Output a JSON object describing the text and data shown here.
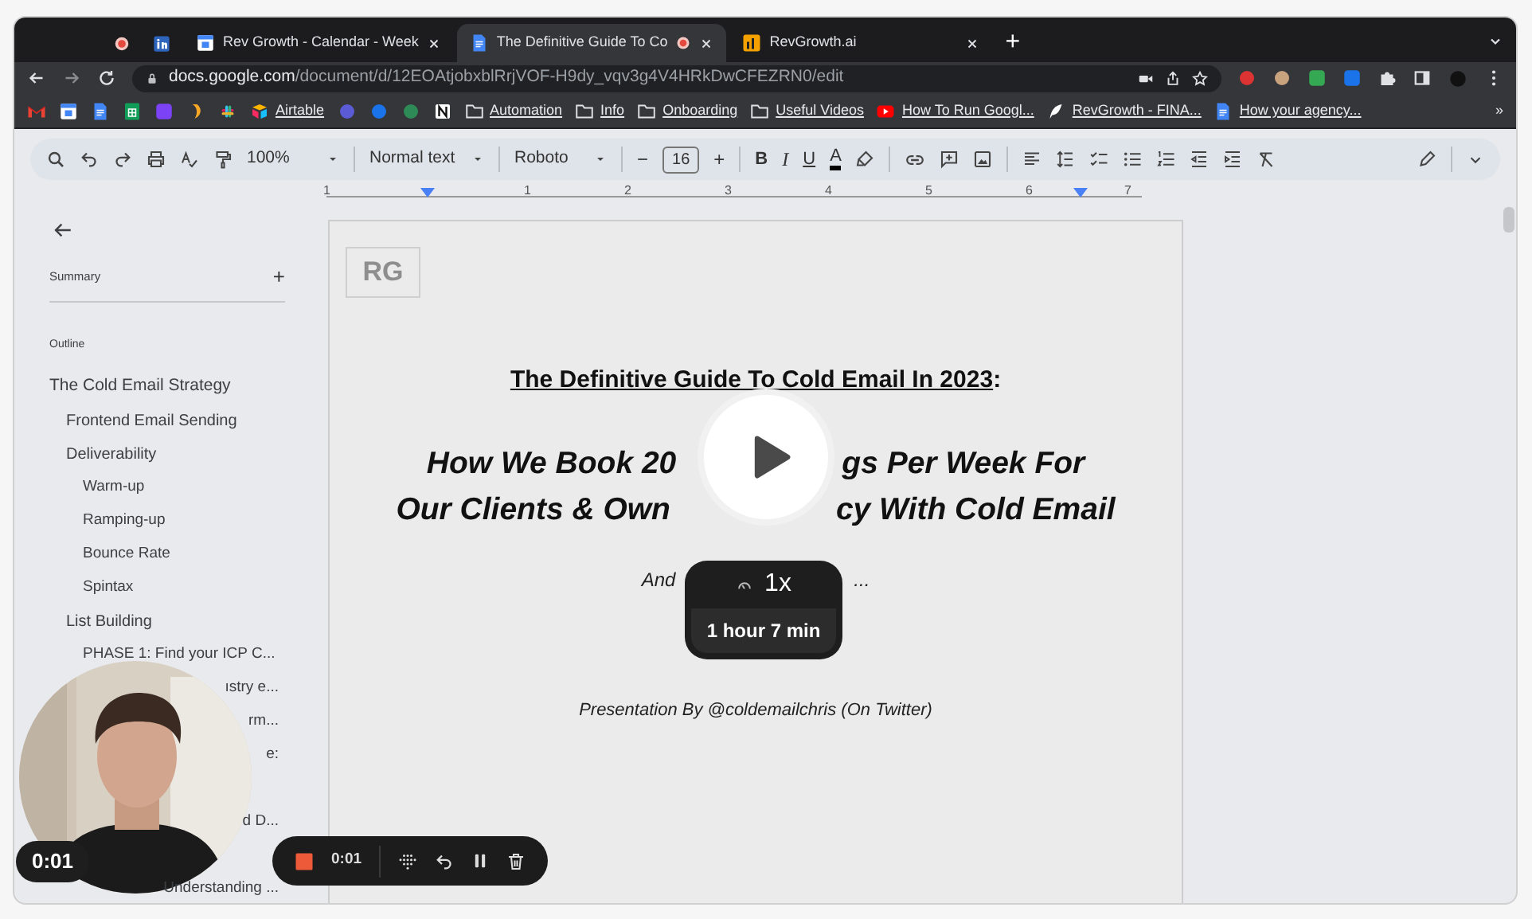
{
  "browser": {
    "tabs": [
      {
        "kind": "pinned",
        "selected": false,
        "recording": true
      },
      {
        "kind": "pinned",
        "selected": false,
        "recording": false
      },
      {
        "kind": "page",
        "title": "Rev Growth - Calendar - Week",
        "selected": false,
        "recording": false
      },
      {
        "kind": "page",
        "title": "The Definitive Guide To Co",
        "selected": true,
        "recording": true
      },
      {
        "kind": "page",
        "title": "RevGrowth.ai",
        "selected": false,
        "recording": false
      }
    ],
    "new_tab": "+",
    "url_domain": "docs.google.com",
    "url_path": "/document/d/12EOAtjobxblRrjVOF-H9dy_vqv3g4V4HRkDwCFEZRN0/edit",
    "bookmarks": [
      "Airtable",
      "Automation",
      "Info",
      "Onboarding",
      "Useful Videos",
      "How To Run Googl...",
      "RevGrowth - FINA...",
      "How your agency..."
    ],
    "bookmarks_more": "»"
  },
  "docs_toolbar": {
    "zoom": "100%",
    "style": "Normal text",
    "font": "Roboto",
    "minus": "−",
    "font_size": "16",
    "plus": "+",
    "bold": "B",
    "italic": "I",
    "underline": "U",
    "text_color": "A"
  },
  "ruler": [
    "1",
    "1",
    "2",
    "3",
    "4",
    "5",
    "6",
    "7"
  ],
  "outline_panel": {
    "summary": "Summary",
    "add": "+",
    "outline_label": "Outline",
    "items": [
      {
        "text": "The Cold Email Strategy",
        "kind": "full",
        "children": [
          {
            "text": "Frontend Email Sending",
            "kind": "full"
          },
          {
            "text": "Deliverability",
            "kind": "full",
            "children": [
              {
                "text": "Warm-up",
                "kind": "full"
              },
              {
                "text": "Ramping-up",
                "kind": "full"
              },
              {
                "text": "Bounce Rate",
                "kind": "full"
              },
              {
                "text": "Spintax",
                "kind": "full"
              }
            ]
          },
          {
            "text": "List Building",
            "kind": "full",
            "children": [
              {
                "text": "PHASE 1: Find your ICP C...",
                "kind": "full"
              },
              {
                "text": "ıstry e...",
                "kind": "partial"
              },
              {
                "text": "rm...",
                "kind": "partial"
              },
              {
                "text": "e:",
                "kind": "partial"
              },
              {
                "text": "d D...",
                "kind": "partial"
              },
              {
                "text": "Understanding ...",
                "kind": "partial"
              }
            ]
          }
        ]
      }
    ]
  },
  "document": {
    "logo": "RG",
    "title": "The Definitive Guide To Cold Email In 2023",
    "title_end": ":",
    "subtitle_lines": [
      [
        "How We Book 20",
        "gs Per Week For"
      ],
      [
        "Our Clients & Own",
        "cy With Cold Email"
      ]
    ],
    "line3": [
      "And",
      "..."
    ],
    "byline": "Presentation By @coldemailchris (On Twitter)"
  },
  "player": {
    "speed": "1x",
    "duration": "1 hour 7 min",
    "camera_time": "0:01",
    "record_time": "0:01"
  }
}
